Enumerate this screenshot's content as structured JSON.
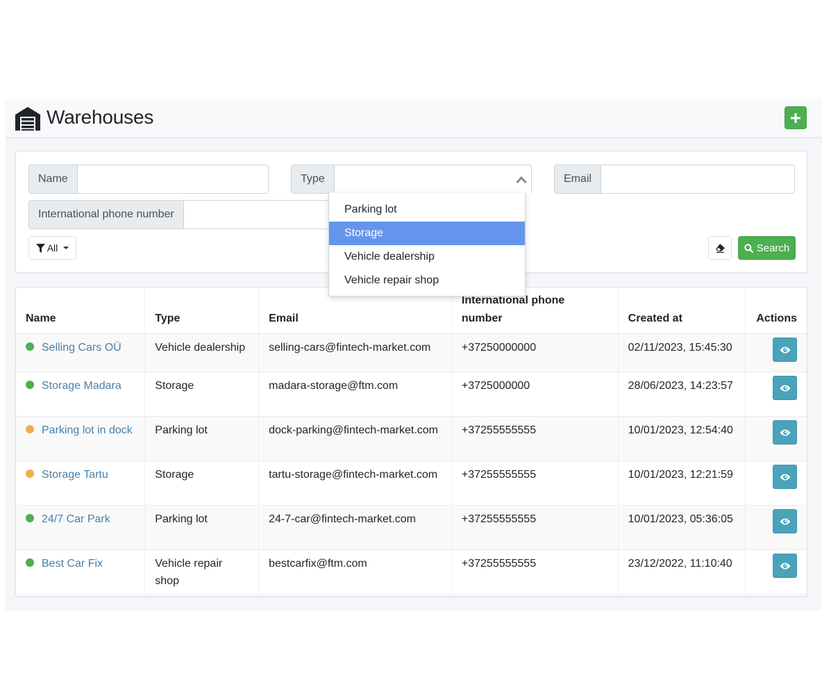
{
  "header": {
    "title": "Warehouses",
    "logo_icon": "warehouse-icon",
    "add_button_icon": "plus-icon"
  },
  "filters": {
    "name": {
      "label": "Name",
      "value": "",
      "placeholder": ""
    },
    "type": {
      "label": "Type",
      "value": "",
      "open": true
    },
    "email": {
      "label": "Email",
      "value": "",
      "placeholder": ""
    },
    "phone": {
      "label": "International phone number",
      "value": "",
      "placeholder": ""
    },
    "status_filter": {
      "label": "All",
      "icon": "filter-icon"
    },
    "clear_button_icon": "eraser-icon",
    "search_button": {
      "label": "Search",
      "icon": "search-icon"
    }
  },
  "type_dropdown": {
    "options": [
      "Parking lot",
      "Storage",
      "Vehicle dealership",
      "Vehicle repair shop"
    ],
    "highlighted": "Storage"
  },
  "colors": {
    "accent_green": "#4caf50",
    "status_active": "#4caf50",
    "status_warning": "#f0ad4e",
    "link": "#4a7fa8",
    "view_button": "#4aa3bb",
    "dropdown_highlight": "#6495ed"
  },
  "table": {
    "columns": [
      "Name",
      "Type",
      "Email",
      "International phone number",
      "Created at",
      "Actions"
    ],
    "rows": [
      {
        "status": "active",
        "name": "Selling Cars OÜ",
        "type": "Vehicle dealership",
        "email": "selling-cars@fintech-market.com",
        "phone": "+37250000000",
        "created_at": "02/11/2023, 15:45:30"
      },
      {
        "status": "active",
        "name": "Storage Madara",
        "type": "Storage",
        "email": "madara-storage@ftm.com",
        "phone": "+3725000000",
        "created_at": "28/06/2023, 14:23:57"
      },
      {
        "status": "warning",
        "name": "Parking lot in dock",
        "type": "Parking lot",
        "email": "dock-parking@fintech-market.com",
        "phone": "+37255555555",
        "created_at": "10/01/2023, 12:54:40"
      },
      {
        "status": "warning",
        "name": "Storage Tartu",
        "type": "Storage",
        "email": "tartu-storage@fintech-market.com",
        "phone": "+37255555555",
        "created_at": "10/01/2023, 12:21:59"
      },
      {
        "status": "active",
        "name": "24/7 Car Park",
        "type": "Parking lot",
        "email": "24-7-car@fintech-market.com",
        "phone": "+37255555555",
        "created_at": "10/01/2023, 05:36:05"
      },
      {
        "status": "active",
        "name": "Best Car Fix",
        "type": "Vehicle repair shop",
        "email": "bestcarfix@ftm.com",
        "phone": "+37255555555",
        "created_at": "23/12/2022, 11:10:40"
      }
    ],
    "action_icon": "eye-icon"
  }
}
